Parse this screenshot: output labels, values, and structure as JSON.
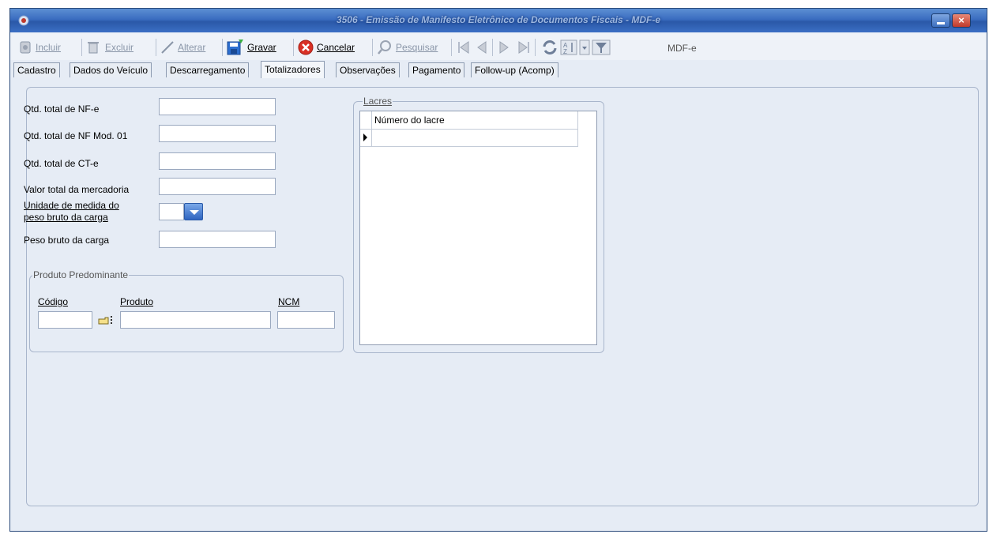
{
  "window": {
    "title": "3506 - Emissão de Manifesto Eletrônico de Documentos Fiscais - MDF-e",
    "minimize_icon": "minimize-icon",
    "close_icon": "close-icon",
    "close_glyph": "×"
  },
  "toolbar": {
    "incluir": "Incluir",
    "excluir": "Excluir",
    "alterar": "Alterar",
    "gravar": "Gravar",
    "cancelar": "Cancelar",
    "pesquisar": "Pesquisar",
    "module_label": "MDF-e"
  },
  "tabs": [
    {
      "label": "Cadastro"
    },
    {
      "label": "Dados do Veículo"
    },
    {
      "label": "Descarregamento"
    },
    {
      "label": "Totalizadores",
      "active": true
    },
    {
      "label": "Observações"
    },
    {
      "label": "Pagamento"
    },
    {
      "label": "Follow-up (Acomp)"
    }
  ],
  "form": {
    "qtd_nfe_label": "Qtd. total de NF-e",
    "qtd_nfe_value": "",
    "qtd_nf_mod01_label": "Qtd. total de NF Mod. 01",
    "qtd_nf_mod01_value": "",
    "qtd_cte_label": "Qtd. total de CT-e",
    "qtd_cte_value": "",
    "valor_total_label": "Valor total da mercadoria",
    "valor_total_value": "",
    "unidade_label_line1": "Unidade de medida do",
    "unidade_label_line2": "peso bruto da carga",
    "unidade_value": "",
    "peso_bruto_label": "Peso bruto da carga",
    "peso_bruto_value": ""
  },
  "produto_predominante": {
    "legend": "Produto Predominante",
    "codigo_label": "Código",
    "produto_label": "Produto",
    "ncm_label": "NCM",
    "codigo_value": "",
    "produto_value": "",
    "ncm_value": ""
  },
  "lacres": {
    "legend": "Lacres",
    "column_header": "Número do lacre",
    "rows": [
      ""
    ]
  },
  "colors": {
    "titlebar": "#3a6cc0",
    "window_bg": "#e6ecf5",
    "close_button": "#c0392b"
  }
}
